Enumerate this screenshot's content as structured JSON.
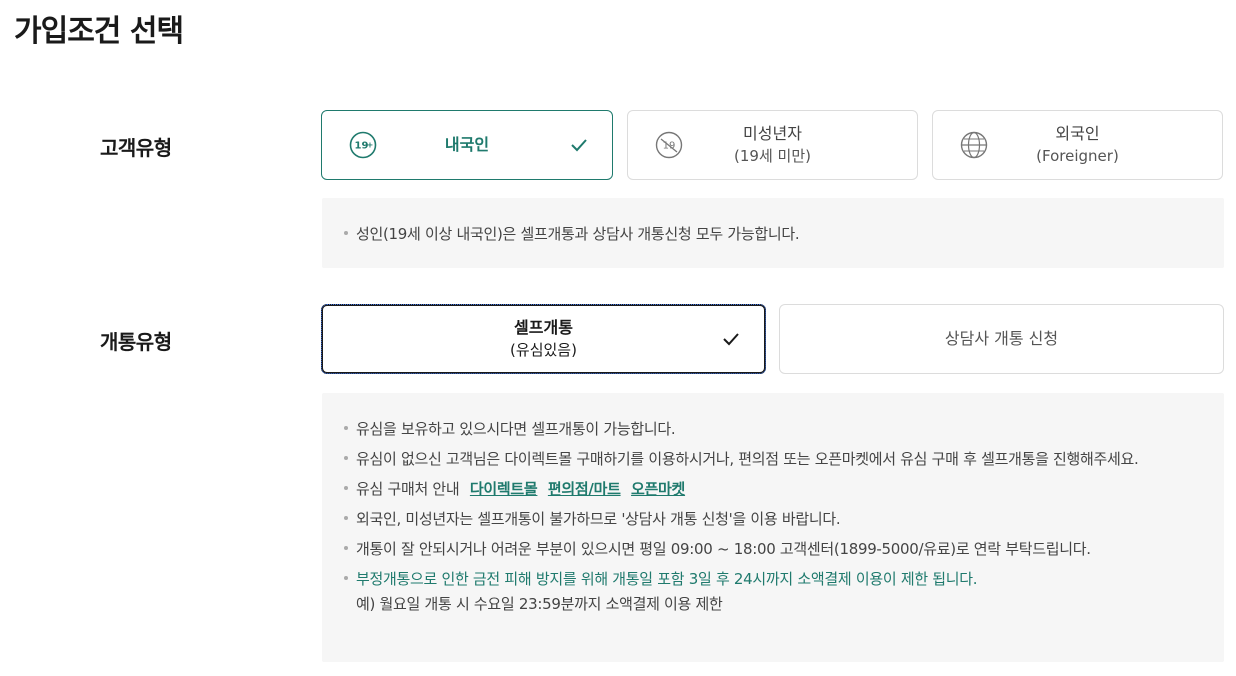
{
  "page": {
    "title": "가입조건 선택"
  },
  "customer_type": {
    "label": "고객유형",
    "options": [
      {
        "label": "내국인",
        "sub": "",
        "icon": "19-plus-icon",
        "selected": true
      },
      {
        "label": "미성년자",
        "sub": "(19세 미만)",
        "icon": "19-minus-icon",
        "selected": false
      },
      {
        "label": "외국인",
        "sub": "(Foreigner)",
        "icon": "globe-icon",
        "selected": false
      }
    ],
    "info": [
      "성인(19세 이상 내국인)은 셀프개통과 상담사 개통신청 모두 가능합니다."
    ]
  },
  "open_type": {
    "label": "개통유형",
    "options": [
      {
        "label": "셀프개통",
        "sub": "(유심있음)",
        "selected": true
      },
      {
        "label": "상담사 개통 신청",
        "sub": "",
        "selected": false
      }
    ],
    "info": {
      "line1": "유심을 보유하고 있으시다면 셀프개통이 가능합니다.",
      "line2": "유심이 없으신 고객님은 다이렉트몰 구매하기를 이용하시거나, 편의점 또는 오픈마켓에서 유심 구매 후 셀프개통을 진행해주세요.",
      "line3_prefix": "유심 구매처 안내",
      "links": [
        "다이렉트몰",
        "편의점/마트",
        "오픈마켓"
      ],
      "line4": "외국인, 미성년자는 셀프개통이 불가하므로 '상담사 개통 신청'을 이용 바랍니다.",
      "line5": "개통이 잘 안되시거나 어려운 부분이 있으시면 평일 09:00 ~ 18:00 고객센터(1899-5000/유료)로 연락 부탁드립니다.",
      "line6": "부정개통으로 인한 금전 피해 방지를 위해 개통일 포함 3일 후 24시까지 소액결제 이용이 제한 됩니다.",
      "line6_sub": "예) 월요일 개통 시 수요일 23:59분까지 소액결제 이용 제한"
    }
  },
  "colors": {
    "accent": "#1f7a6d",
    "panel": "#f6f6f6",
    "border": "#dcdcdc"
  }
}
